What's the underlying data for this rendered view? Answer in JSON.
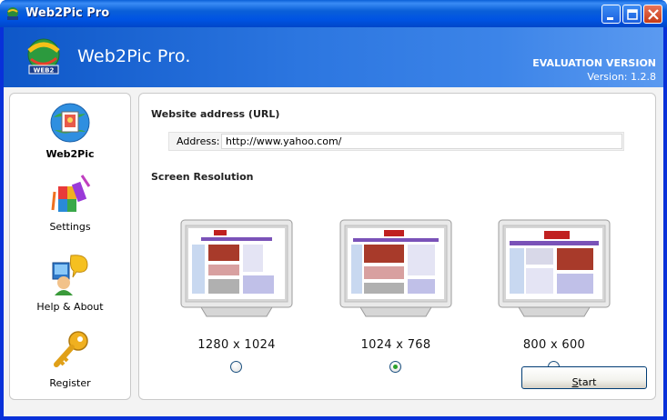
{
  "window": {
    "title": "Web2Pic Pro",
    "controls": {
      "minimize": "minimize-icon",
      "maximize": "maximize-icon",
      "close": "close-icon"
    }
  },
  "banner": {
    "title": "Web2Pic Pro.",
    "edition": "EVALUATION VERSION",
    "version": "Version: 1.2.8",
    "logo_text": "WEB2"
  },
  "nav": {
    "items": [
      {
        "label": "Web2Pic",
        "icon": "web2pic-icon",
        "active": true
      },
      {
        "label": "Settings",
        "icon": "settings-icon",
        "active": false
      },
      {
        "label": "Help & About",
        "icon": "help-icon",
        "active": false
      },
      {
        "label": "Register",
        "icon": "key-icon",
        "active": false
      }
    ]
  },
  "main": {
    "url_section_title": "Website address (URL)",
    "address_label": "Address:",
    "address_value": "http://www.yahoo.com/",
    "resolution_section_title": "Screen Resolution",
    "resolutions": [
      {
        "label": "1280 x 1024",
        "selected": false
      },
      {
        "label": "1024 x 768",
        "selected": true
      },
      {
        "label": "800 x 600",
        "selected": false
      }
    ],
    "start_button": {
      "mnemonic": "S",
      "rest": "tart"
    }
  },
  "colors": {
    "titlebar": "#0054e3",
    "banner": "#2c76e0",
    "radio_selected": "#2ba02b"
  }
}
